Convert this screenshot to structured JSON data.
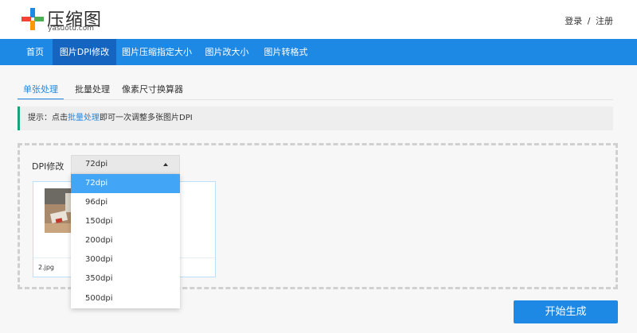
{
  "brand": {
    "name": "压缩图",
    "domain": "yasuotu.com"
  },
  "auth": {
    "login": "登录",
    "separator": "/",
    "register": "注册"
  },
  "nav": {
    "items": [
      {
        "label": "首页"
      },
      {
        "label": "图片DPI修改"
      },
      {
        "label": "图片压缩指定大小"
      },
      {
        "label": "图片改大小"
      },
      {
        "label": "图片转格式"
      }
    ],
    "active_index": 1
  },
  "subtabs": [
    {
      "label": "单张处理"
    },
    {
      "label": "批量处理"
    },
    {
      "label": "像素尺寸换算器"
    }
  ],
  "tip": {
    "prefix": "提示：点击",
    "link": "批量处理",
    "suffix": "即可一次调整多张图片DPI"
  },
  "dpi": {
    "label": "DPI修改",
    "selected": "72dpi",
    "options": [
      "72dpi",
      "96dpi",
      "150dpi",
      "200dpi",
      "300dpi",
      "350dpi",
      "500dpi"
    ]
  },
  "file": {
    "name": "2.jpg"
  },
  "start_button": "开始生成",
  "colors": {
    "accent": "#1e88e5",
    "nav_active": "#1565c0",
    "option_selected": "#42a5f5",
    "tip_border": "#1aa37a"
  }
}
